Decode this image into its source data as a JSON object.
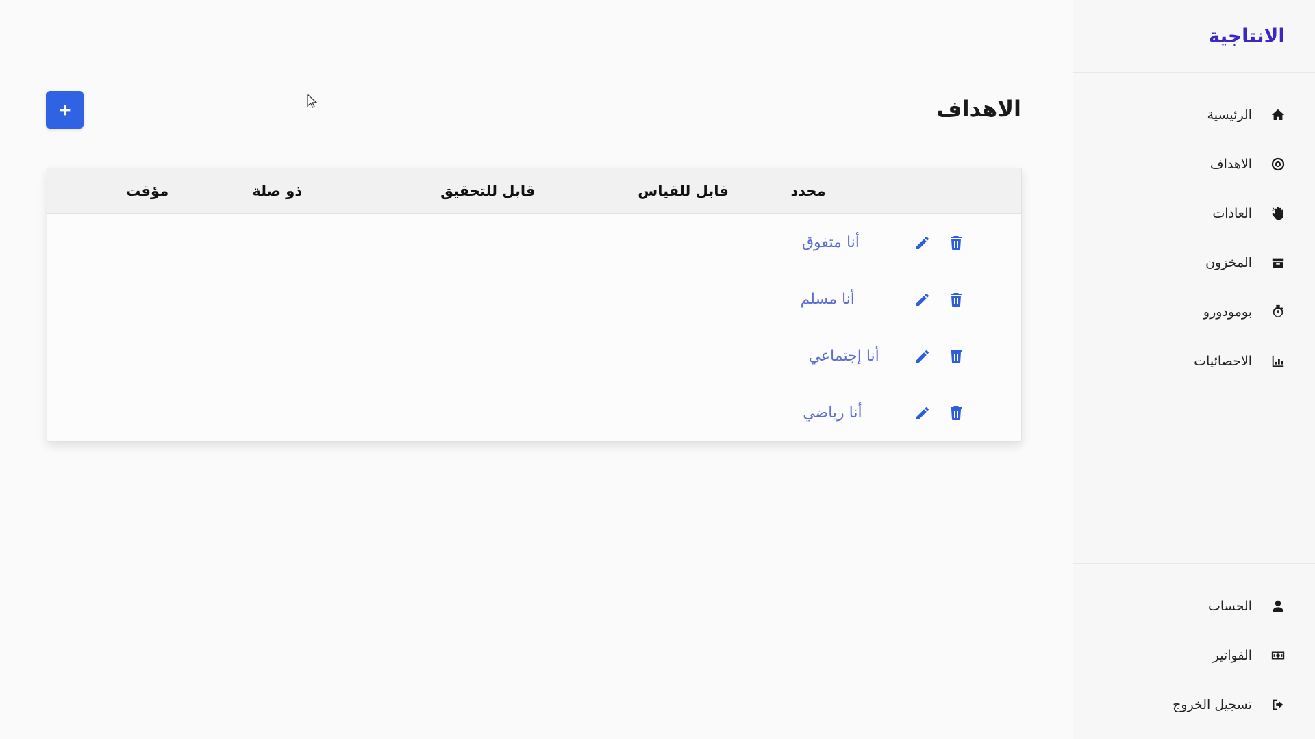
{
  "app": {
    "brand": "الانتاجية"
  },
  "sidebar": {
    "items": [
      {
        "label": "الرئيسية",
        "icon": "home-icon"
      },
      {
        "label": "الاهداف",
        "icon": "target-icon"
      },
      {
        "label": "العادات",
        "icon": "hand-icon"
      },
      {
        "label": "المخزون",
        "icon": "box-icon"
      },
      {
        "label": "بومودورو",
        "icon": "stopwatch-icon"
      },
      {
        "label": "الاحصائيات",
        "icon": "chart-icon"
      }
    ],
    "bottom_items": [
      {
        "label": "الحساب",
        "icon": "user-icon"
      },
      {
        "label": "الفواتير",
        "icon": "money-bill-icon"
      },
      {
        "label": "تسجيل الخروج",
        "icon": "sign-out-icon"
      }
    ]
  },
  "main": {
    "title": "الاهداف",
    "add_button_icon": "plus-icon",
    "table": {
      "headers": [
        "محدد",
        "قابل للقياس",
        "قابل للتحقيق",
        "ذو صلة",
        "مؤقت"
      ],
      "rows": [
        {
          "specific": "أنا متفوق"
        },
        {
          "specific": "أنا مسلم"
        },
        {
          "specific": "أنا إجتماعي"
        },
        {
          "specific": "أنا رياضي"
        }
      ],
      "row_actions": {
        "edit_icon": "pencil-icon",
        "delete_icon": "trash-icon"
      }
    }
  },
  "colors": {
    "brand": "#3b28c4",
    "primary": "#2f63e4",
    "goal_text": "#5b6fd4"
  }
}
